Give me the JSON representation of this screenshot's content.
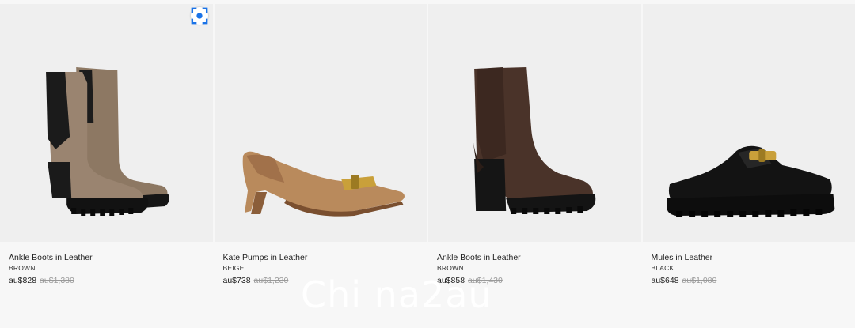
{
  "products": [
    {
      "name": "Ankle Boots in Leather",
      "color": "BROWN",
      "price": "au$828",
      "original_price": "au$1,380",
      "image_icon": "chelsea-boot-icon"
    },
    {
      "name": "Kate Pumps in Leather",
      "color": "BEIGE",
      "price": "au$738",
      "original_price": "au$1,230",
      "image_icon": "pump-shoe-icon"
    },
    {
      "name": "Ankle Boots in Leather",
      "color": "BROWN",
      "price": "au$858",
      "original_price": "au$1,430",
      "image_icon": "heeled-boot-icon"
    },
    {
      "name": "Mules in Leather",
      "color": "BLACK",
      "price": "au$648",
      "original_price": "au$1,080",
      "image_icon": "mule-loafer-icon"
    }
  ],
  "overlay": {
    "lens_icon": "visual-search-icon",
    "watermark": "Chi na2au"
  },
  "colors": {
    "card_background": "#efefef",
    "page_background": "#f7f7f7",
    "text": "#222222",
    "strikethrough_price": "#9a9a9a"
  }
}
